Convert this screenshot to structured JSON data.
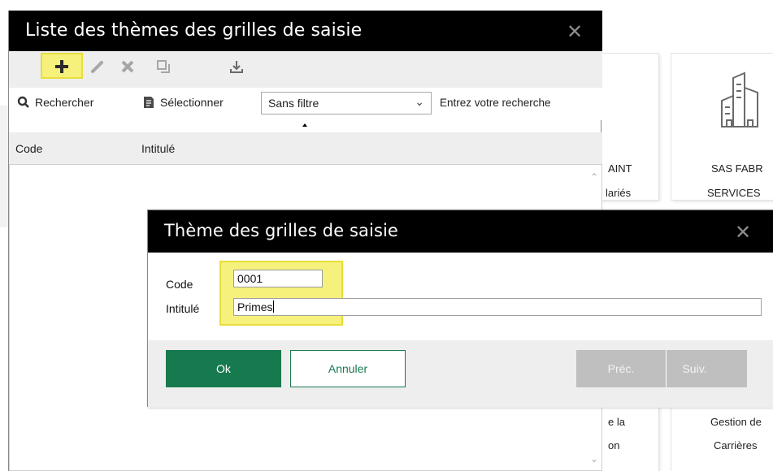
{
  "background_tiles": {
    "tile1_line1": "AINT",
    "tile1_line2": "lariés",
    "tile2_line1": "SAS FABR",
    "tile2_line2": "SERVICES",
    "tile3_line1": "e la",
    "tile3_line2": "on",
    "tile4_line1": "Gestion de",
    "tile4_line2": "Carrières",
    "icon": "building-icon"
  },
  "list_window": {
    "title": "Liste des thèmes des grilles de saisie",
    "close_glyph": "✕",
    "toolbar": {
      "add_icon": "plus-icon",
      "edit_icon": "pencil-icon",
      "delete_icon": "x-icon",
      "copy_icon": "copy-icon",
      "export_icon": "export-icon"
    },
    "search": {
      "rechercher_label": "Rechercher",
      "selectionner_label": "Sélectionner",
      "filter_value": "Sans filtre",
      "hint": "Entrez votre recherche"
    },
    "columns": [
      "Code",
      "Intitulé"
    ]
  },
  "dialog": {
    "title": "Thème des grilles de saisie",
    "close_glyph": "✕",
    "code_label": "Code",
    "code_value": "0001",
    "intitule_label": "Intitulé",
    "intitule_value": "Primes",
    "ok_label": "Ok",
    "annuler_label": "Annuler",
    "prec_label": "Préc.",
    "suiv_label": "Suiv."
  },
  "colors": {
    "titlebar": "#000000",
    "ok_button": "#177a4f",
    "annuler_border": "#177a4f",
    "highlight": "#f6f17c",
    "toolbar_bg": "#eeeeee",
    "disabled_button": "#bfbfbf"
  }
}
